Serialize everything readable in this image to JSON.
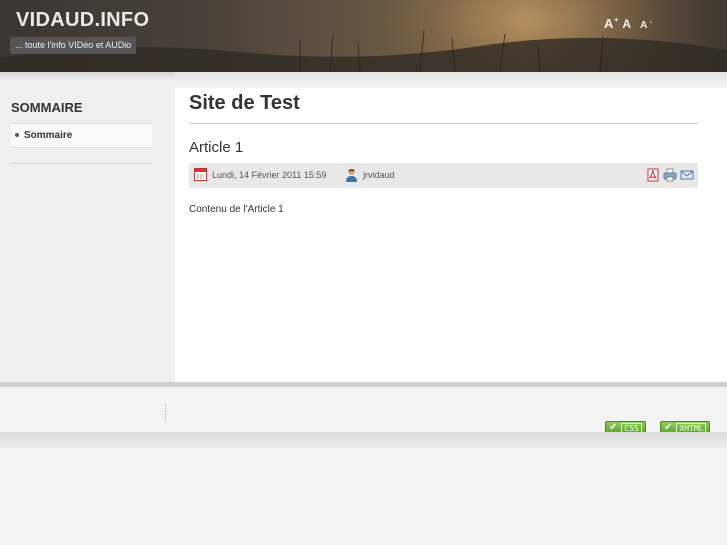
{
  "header": {
    "site_title": "VIDAUD.INFO",
    "tagline": "... toute l'info VIDéo et AUDio",
    "font_controls": {
      "increase": "A",
      "increase_sup": "+",
      "reset": "A",
      "decrease": "A",
      "decrease_sup": "-"
    }
  },
  "sidebar": {
    "title": "SOMMAIRE",
    "items": [
      {
        "label": "Sommaire"
      }
    ]
  },
  "main": {
    "page_title": "Site de Test",
    "article": {
      "title": "Article 1",
      "date": "Lundi, 14 Février 2011 15:59",
      "author": "jrvidaud",
      "body": "Contenu de l'Article 1",
      "actions": [
        "pdf-icon",
        "print-icon",
        "email-icon"
      ]
    }
  },
  "footer": {
    "badges": [
      {
        "label": "CSS"
      },
      {
        "label": "XHTML"
      }
    ]
  },
  "colors": {
    "header_bg": "#4a433c",
    "accent_green": "#5aa32d",
    "text": "#333333"
  }
}
